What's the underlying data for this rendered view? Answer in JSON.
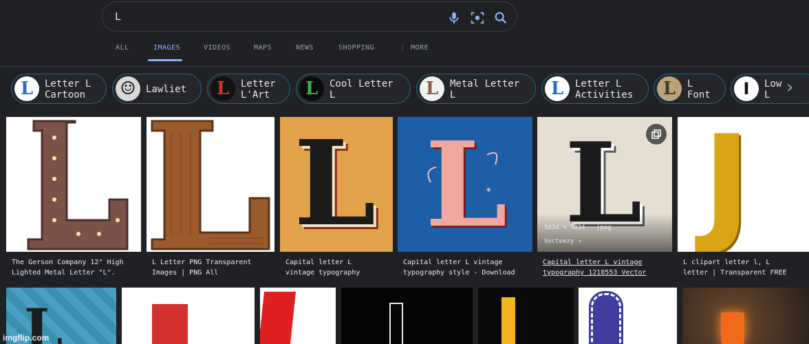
{
  "search": {
    "query": "L"
  },
  "tabs": [
    {
      "label": "ALL"
    },
    {
      "label": "IMAGES",
      "active": true
    },
    {
      "label": "VIDEOS"
    },
    {
      "label": "MAPS"
    },
    {
      "label": "NEWS"
    },
    {
      "label": "SHOPPING"
    },
    {
      "label": "⋮ MORE"
    }
  ],
  "chips": [
    {
      "line1": "Letter L",
      "line2": "Cartoon"
    },
    {
      "line1": "Lawliet",
      "line2": ""
    },
    {
      "line1": "Letter",
      "line2": "L'Art"
    },
    {
      "line1": "Cool Letter",
      "line2": "L"
    },
    {
      "line1": "Metal Letter",
      "line2": "L"
    },
    {
      "line1": "Letter L",
      "line2": "Activities"
    },
    {
      "line1": "L",
      "line2": "Font"
    },
    {
      "line1": "Low",
      "line2": "L"
    }
  ],
  "results": [
    {
      "caption1": "The Gerson Company 12\" High",
      "caption2": "Lighted Metal Letter \"L\"."
    },
    {
      "caption1": "L Letter PNG Transparent",
      "caption2": "Images | PNG All"
    },
    {
      "caption1": "Capital letter L",
      "caption2": "vintage typography"
    },
    {
      "caption1": "Capital letter L vintage",
      "caption2": "typography style - Download"
    },
    {
      "caption1": "Capital letter L vintage",
      "caption2": "typography 1218553 Vector",
      "dimensions": "5834 × 5834 · jpeg",
      "source": "Vecteezy ↗"
    },
    {
      "caption1": "L clipart letter l, L",
      "caption2": "letter | Transparent FREE"
    }
  ],
  "watermark": "imgflip.com",
  "colors": {
    "accent": "#8ab4f8",
    "background": "#202124",
    "chip_border": "#1e6b93"
  }
}
